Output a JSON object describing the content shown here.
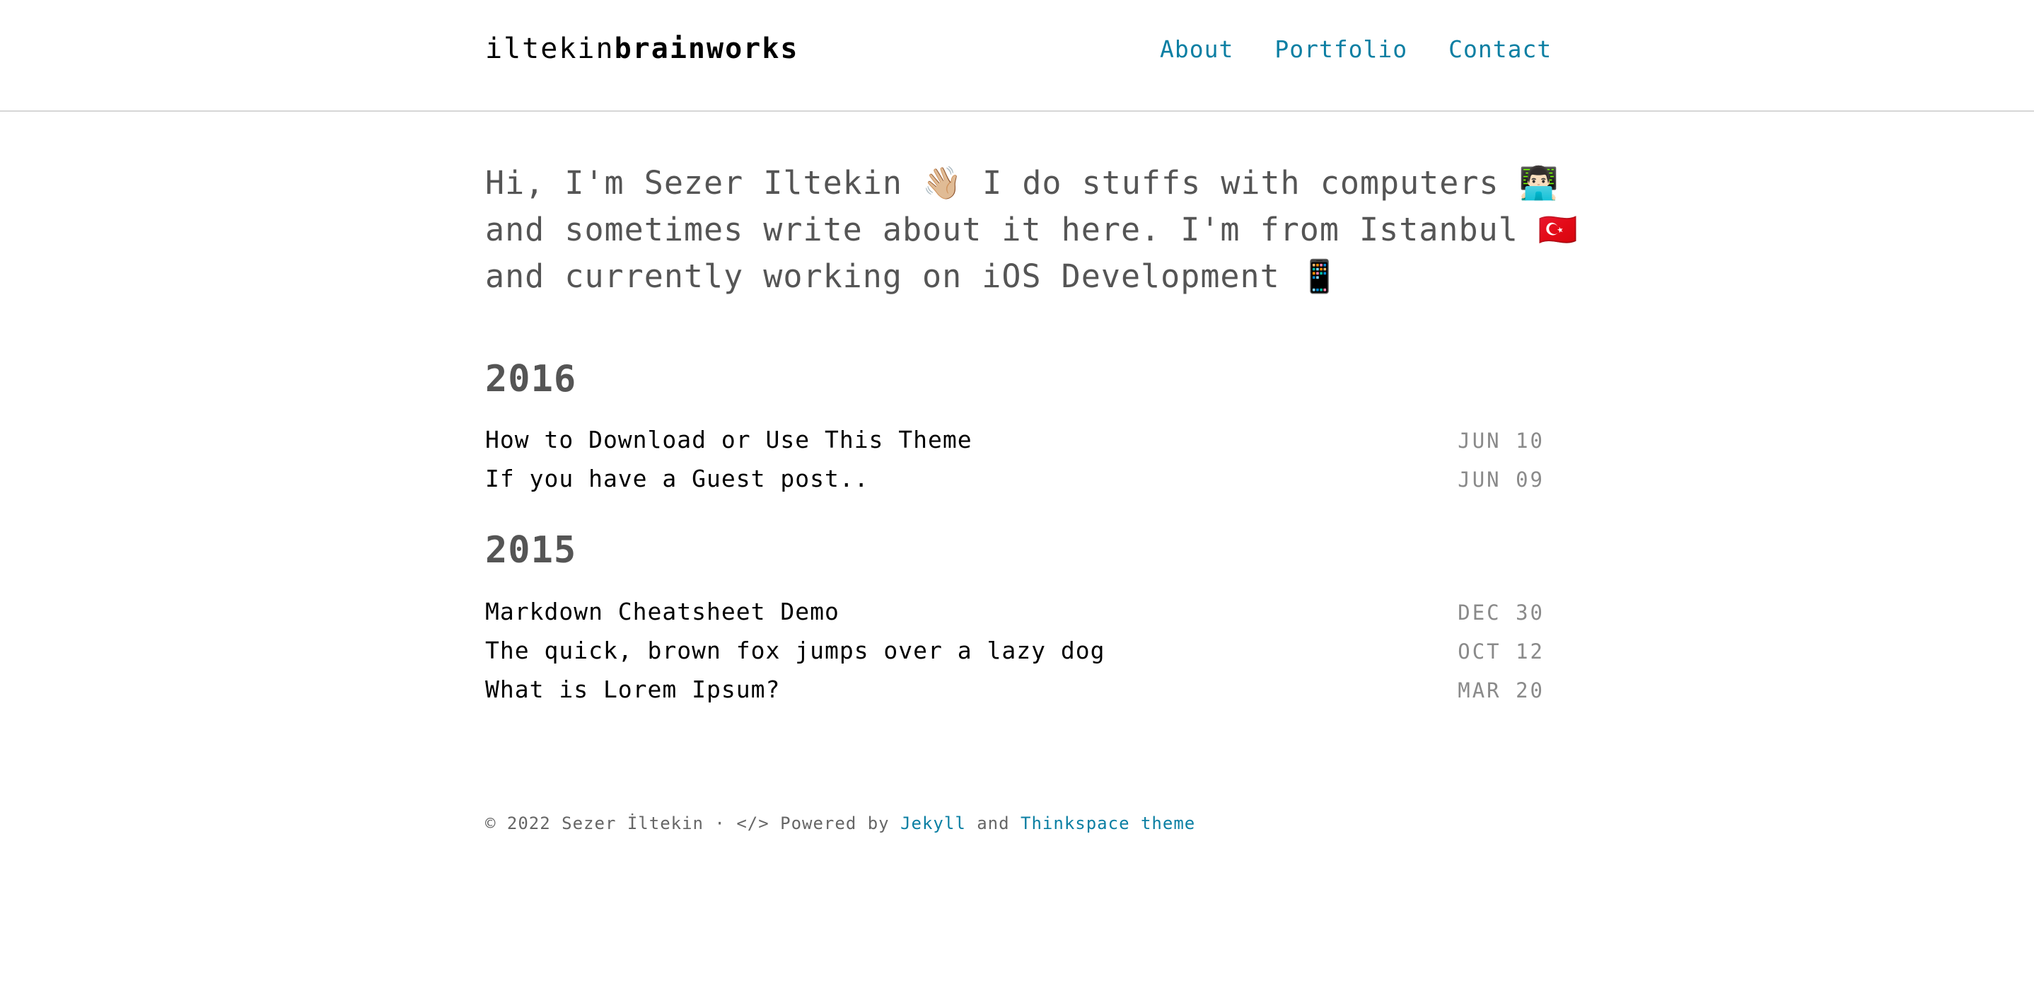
{
  "header": {
    "brand_regular": "iltekin",
    "brand_bold": "brainworks",
    "nav": [
      {
        "label": "About"
      },
      {
        "label": "Portfolio"
      },
      {
        "label": "Contact"
      }
    ]
  },
  "intro": {
    "line1": "Hi, I'm Sezer Iltekin 👋🏼 I do stuffs with computers 👨🏻‍💻",
    "line2": "and sometimes write about it here. I'm from Istanbul 🇹🇷",
    "line3": "and currently working on iOS Development 📱"
  },
  "years": [
    {
      "year": "2016",
      "posts": [
        {
          "title": "How to Download or Use This Theme",
          "date": "JUN 10"
        },
        {
          "title": "If you have a Guest post..",
          "date": "JUN 09"
        }
      ]
    },
    {
      "year": "2015",
      "posts": [
        {
          "title": "Markdown Cheatsheet Demo",
          "date": "DEC 30"
        },
        {
          "title": "The quick, brown fox jumps over a lazy dog",
          "date": "OCT 12"
        },
        {
          "title": "What is Lorem Ipsum?",
          "date": "MAR 20"
        }
      ]
    }
  ],
  "footer": {
    "prefix": "© 2022 Sezer İltekin · </> Powered by ",
    "jekyll": "Jekyll",
    "and": " and ",
    "theme": "Thinkspace theme"
  }
}
